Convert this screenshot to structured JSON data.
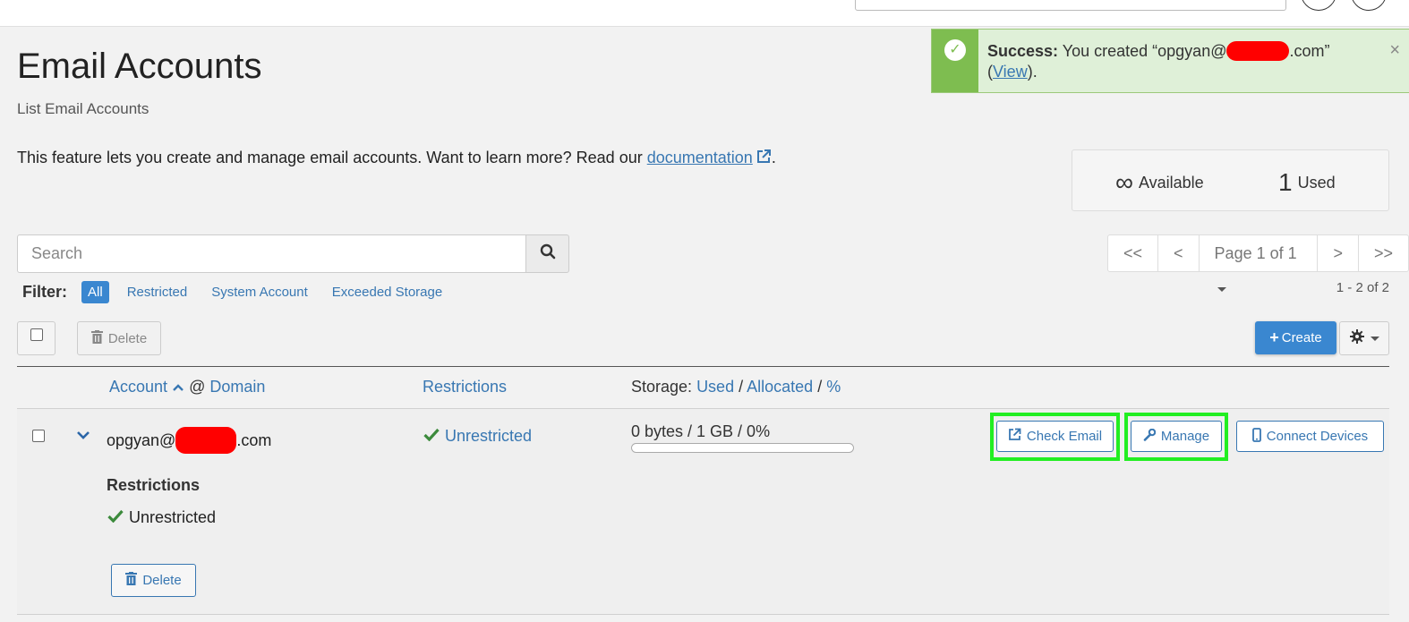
{
  "page": {
    "title": "Email Accounts",
    "subtitle": "List Email Accounts",
    "intro_text": "This feature lets you create and manage email accounts. Want to learn more? Read our ",
    "intro_link": "documentation",
    "intro_end": "."
  },
  "alert": {
    "bold": "Success:",
    "text_before": " You created “opgyan@",
    "text_after": ".com”",
    "paren_open": "(",
    "link": "View",
    "paren_close": ").",
    "close": "×"
  },
  "stats": {
    "available_symbol": "∞",
    "available_label": "Available",
    "used_value": "1",
    "used_label": "Used"
  },
  "search": {
    "placeholder": "Search"
  },
  "pager": {
    "first": "<<",
    "prev": "<",
    "page_label": "Page 1 of 1",
    "next": ">",
    "last": ">>",
    "range": "1 - 2 of 2"
  },
  "filter": {
    "label": "Filter:",
    "options": [
      "All",
      "Restricted",
      "System Account",
      "Exceeded Storage"
    ],
    "active": "All"
  },
  "toolbar": {
    "delete_label": "Delete",
    "create_label": "Create"
  },
  "table": {
    "col_account": "Account",
    "col_at": "@",
    "col_domain": "Domain",
    "col_restrictions": "Restrictions",
    "col_storage_prefix": "Storage:",
    "col_used": "Used",
    "slash": "/",
    "col_allocated": "Allocated",
    "col_percent": "%"
  },
  "row": {
    "account_prefix": "opgyan@",
    "account_suffix": ".com",
    "restriction": "Unrestricted",
    "storage": "0 bytes / 1 GB / 0%",
    "usage_fraction": 0,
    "check_email": "Check Email",
    "manage": "Manage",
    "connect_devices": "Connect Devices",
    "detail_heading": "Restrictions",
    "detail_value": "Unrestricted",
    "detail_delete": "Delete"
  },
  "colors": {
    "accent": "#3a87d0",
    "link": "#3877b2",
    "success": "#7ebd50",
    "success_bg": "#dff0d8",
    "check": "#3c8a3c",
    "highlight": "#22ee22",
    "redaction": "#ff0000"
  }
}
